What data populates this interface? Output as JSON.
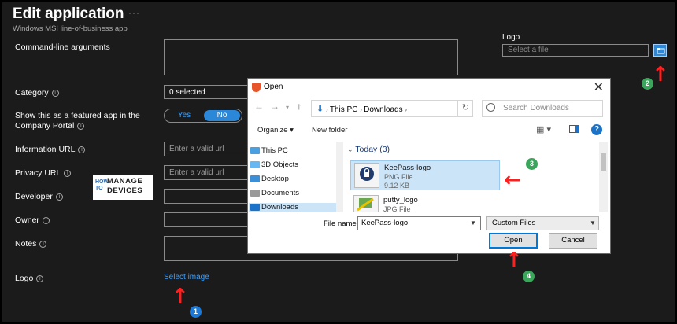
{
  "page": {
    "title": "Edit application",
    "more": "···",
    "subtitle": "Windows MSI line-of-business app"
  },
  "form": {
    "command_line_label": "Command-line arguments",
    "category_label": "Category",
    "category_value": "0 selected",
    "featured_label": "Show this as a featured app in the Company Portal",
    "toggle_yes": "Yes",
    "toggle_no": "No",
    "info_url_label": "Information URL",
    "info_url_placeholder": "Enter a valid url",
    "privacy_url_label": "Privacy URL",
    "privacy_url_placeholder": "Enter a valid url",
    "developer_label": "Developer",
    "owner_label": "Owner",
    "notes_label": "Notes",
    "logo_label": "Logo",
    "select_image_link": "Select image"
  },
  "watermark": {
    "how": "HOW TO",
    "manage": "MANAGE",
    "devices": "DEVICES"
  },
  "right_panel": {
    "logo_label": "Logo",
    "select_file_placeholder": "Select a file"
  },
  "dialog": {
    "title": "Open",
    "path": [
      "This PC",
      "Downloads"
    ],
    "search_placeholder": "Search Downloads",
    "organize": "Organize ▾",
    "new_folder": "New folder",
    "tree": [
      "This PC",
      "3D Objects",
      "Desktop",
      "Documents",
      "Downloads"
    ],
    "group_label": "Today (3)",
    "files": [
      {
        "name": "KeePass-logo",
        "type": "PNG File",
        "size": "9.12 KB"
      },
      {
        "name": "putty_logo",
        "type": "JPG File"
      }
    ],
    "filename_label": "File name:",
    "filename_value": "KeePass-logo",
    "filter_value": "Custom Files",
    "open_button": "Open",
    "cancel_button": "Cancel"
  },
  "annotations": {
    "step1": "1",
    "step2": "2",
    "step3": "3",
    "step4": "4",
    "colors": {
      "arrow": "#ff1f1f",
      "badge_blue": "#1e7ad6",
      "badge_green": "#3aa55b"
    }
  }
}
